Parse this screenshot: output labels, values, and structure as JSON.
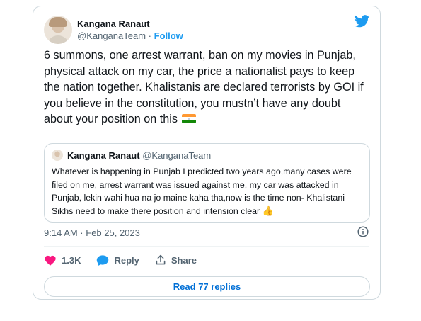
{
  "tweet": {
    "author": {
      "name": "Kangana Ranaut",
      "handle": "@KanganaTeam",
      "separator": "·",
      "follow_label": "Follow"
    },
    "text": "6 summons, one arrest warrant, ban on my movies in Punjab, physical attack on my car, the price a nationalist pays to keep the nation together. Khalistanis are declared terrorists by GOI if you believe in the constitution, you mustn’t have any doubt about your position on this",
    "flag_icon": "india-flag-emoji",
    "quoted": {
      "name": "Kangana Ranaut",
      "handle": "@KanganaTeam",
      "text": "Whatever is happening in Punjab I predicted two years ago,many cases were filed on me, arrest warrant was issued against me, my car was attacked in Punjab, lekin wahi hua na jo maine kaha tha,now is the time non- Khalistani Sikhs need to make there position and intension clear",
      "emoji": "👍"
    },
    "timestamp": "9:14 AM · Feb 25, 2023",
    "likes": "1.3K",
    "reply_label": "Reply",
    "share_label": "Share",
    "read_replies_label": "Read 77 replies"
  },
  "colors": {
    "brand": "#1d9bf0",
    "like": "#f91880",
    "link": "#006fd6",
    "secondary_text": "#536471",
    "border": "#cfd9de"
  },
  "icons": [
    "twitter-bird-icon",
    "info-icon",
    "heart-icon",
    "reply-bubble-icon",
    "share-icon"
  ]
}
